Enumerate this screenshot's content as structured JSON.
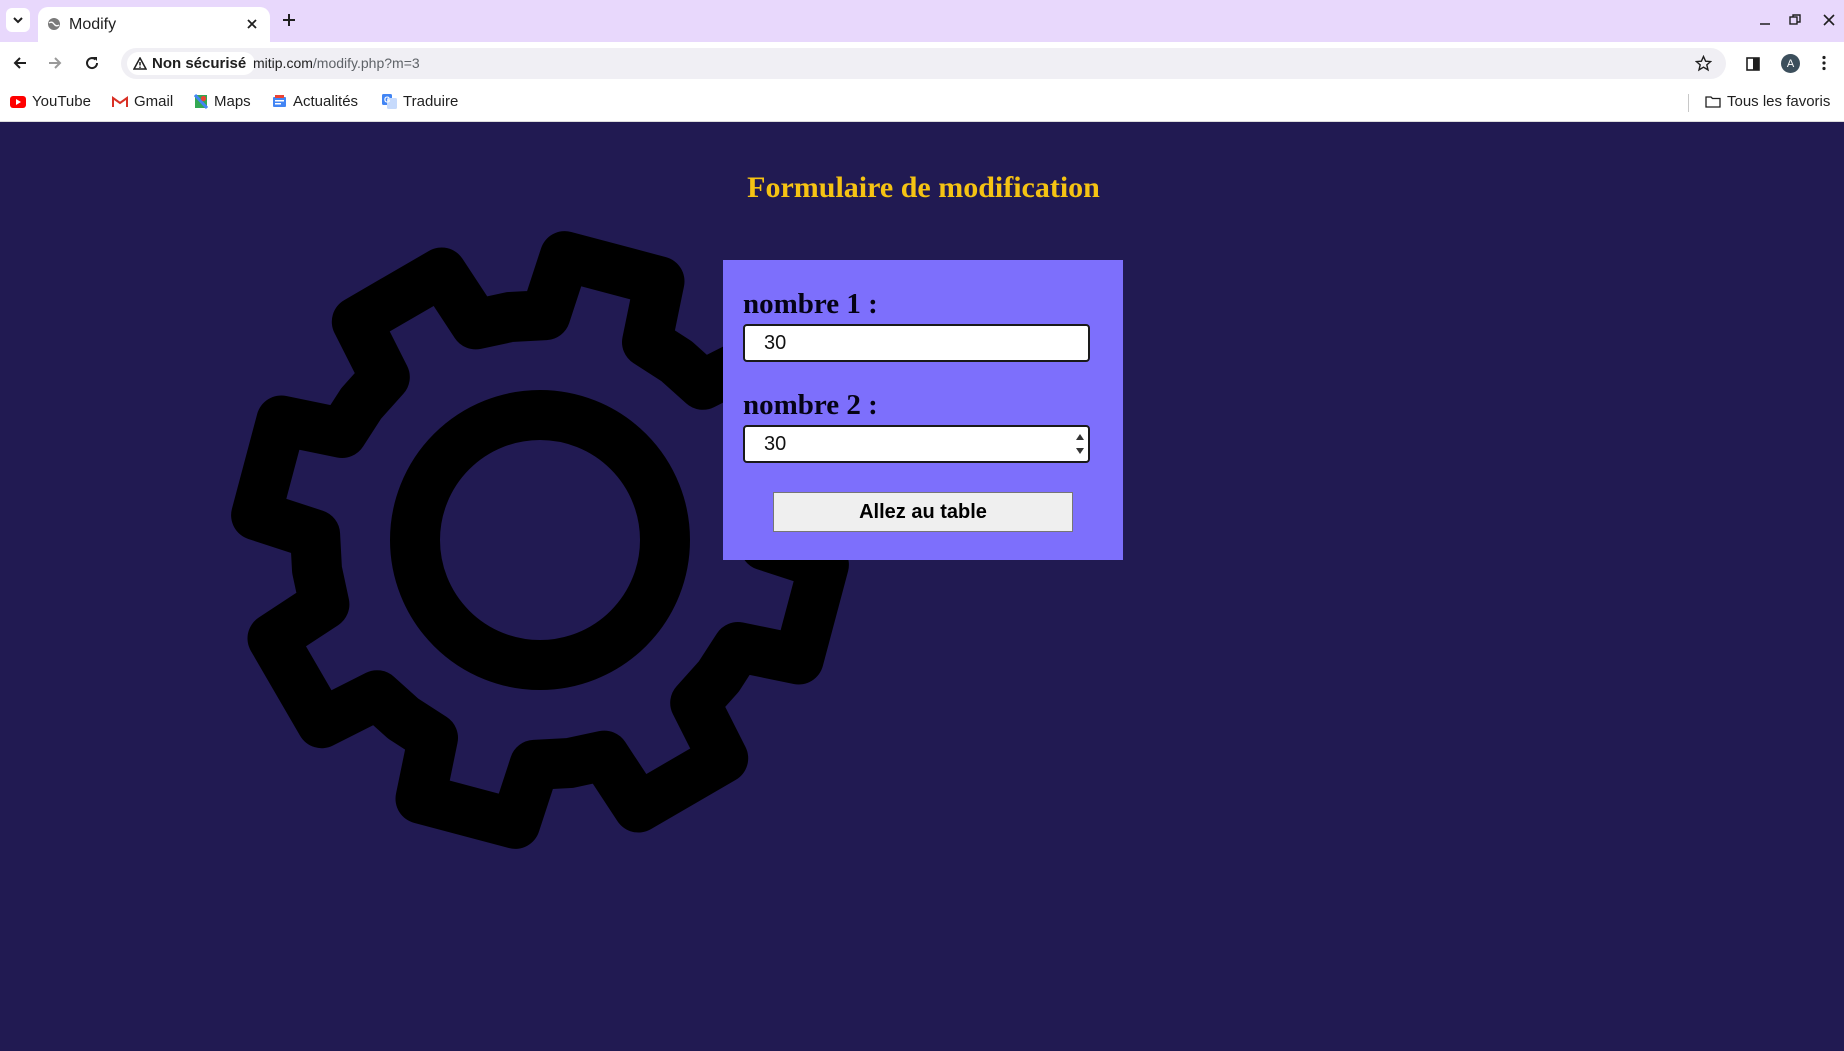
{
  "browser": {
    "tab": {
      "title": "Modify",
      "favicon": "globe-icon"
    },
    "address_bar": {
      "security_label": "Non sécurisé",
      "domain": "mitip.com",
      "path": "/modify.php?m=3"
    },
    "profile_initial": "A",
    "bookmarks": [
      {
        "label": "YouTube",
        "icon": "youtube-icon"
      },
      {
        "label": "Gmail",
        "icon": "gmail-icon"
      },
      {
        "label": "Maps",
        "icon": "maps-icon"
      },
      {
        "label": "Actualités",
        "icon": "news-icon"
      },
      {
        "label": "Traduire",
        "icon": "translate-icon"
      }
    ],
    "all_bookmarks_label": "Tous les favoris"
  },
  "page": {
    "title": "Formulaire de modification",
    "background_color": "#211a52",
    "title_color": "#f5c313",
    "panel_color": "#7d6ffc",
    "decoration": "gear-icon",
    "form": {
      "field1": {
        "label": "nombre 1 :",
        "value": "30"
      },
      "field2": {
        "label": "nombre 2 :",
        "value": "30"
      },
      "submit_label": "Allez au table"
    }
  }
}
